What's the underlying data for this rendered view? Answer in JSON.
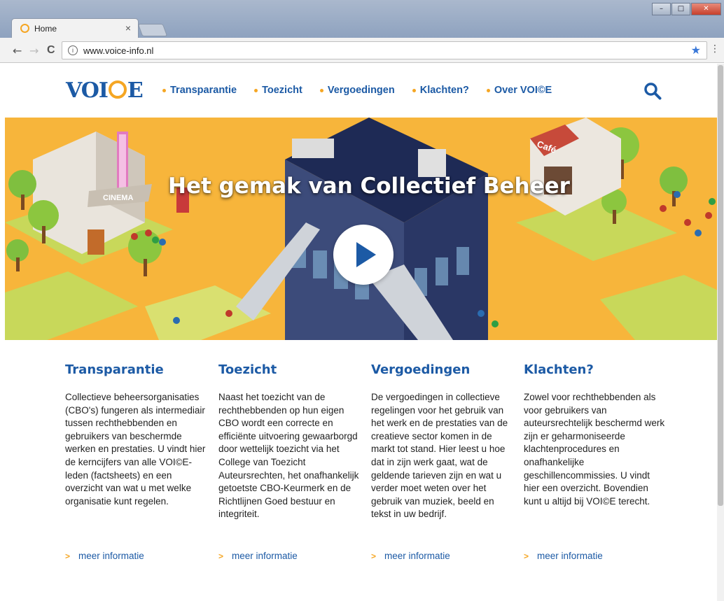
{
  "browser": {
    "tab_title": "Home",
    "tab_close": "×",
    "url": "www.voice-info.nl",
    "info_glyph": "i",
    "back": "←",
    "forward": "→",
    "reload": "C",
    "star": "★",
    "menu": "⋮",
    "win_min": "–",
    "win_max": "□",
    "win_close": "✕"
  },
  "site": {
    "logo_left": "VOI",
    "logo_right": "E",
    "nav": [
      {
        "label": "Transparantie"
      },
      {
        "label": "Toezicht"
      },
      {
        "label": "Vergoedingen"
      },
      {
        "label": "Klachten?"
      },
      {
        "label": "Over VOI©E"
      }
    ]
  },
  "hero": {
    "title": "Het gemak van Collectief Beheer",
    "cafe_sign": "Café",
    "cinema_sign": "CINEMA"
  },
  "columns": [
    {
      "title": "Transparantie",
      "body": "Collectieve beheersorganisaties (CBO's) fungeren als intermediair tussen rechthebbenden en gebruikers van beschermde werken en prestaties. U vindt hier de kerncijfers van alle VOI©E-leden (factsheets) en een overzicht van wat u met welke organisatie kunt regelen.",
      "link": "meer informatie"
    },
    {
      "title": "Toezicht",
      "body": "Naast het toezicht van de rechthebbenden op hun eigen CBO wordt een correcte en efficiënte uitvoering gewaarborgd door wettelijk toezicht via het College van Toezicht Auteursrechten, het onafhankelijk getoetste CBO-Keurmerk en de Richtlijnen Goed bestuur en integriteit.",
      "link": "meer informatie"
    },
    {
      "title": "Vergoedingen",
      "body": "De vergoedingen in collectieve regelingen voor het gebruik van het werk en de prestaties van de creatieve sector komen in de markt tot stand. Hier leest u hoe dat in zijn werk gaat, wat de geldende tarieven zijn en wat u verder moet weten over het gebruik van muziek, beeld en tekst in uw bedrijf.",
      "link": "meer informatie"
    },
    {
      "title": "Klachten?",
      "body": "Zowel voor rechthebbenden als voor gebruikers van auteursrechtelijk beschermd werk zijn er geharmoniseerde klachtenprocedures en onafhankelijke geschillencommissies. U vindt hier een overzicht. Bovendien kunt u altijd bij VOI©E terecht.",
      "link": "meer informatie"
    }
  ],
  "colors": {
    "brand_blue": "#1c5aa5",
    "accent_orange": "#f5a623",
    "hero_background": "#f7b53b"
  },
  "icons": [
    "info-icon",
    "star-icon",
    "search-icon",
    "play-icon",
    "chevron-right-icon",
    "close-icon"
  ]
}
